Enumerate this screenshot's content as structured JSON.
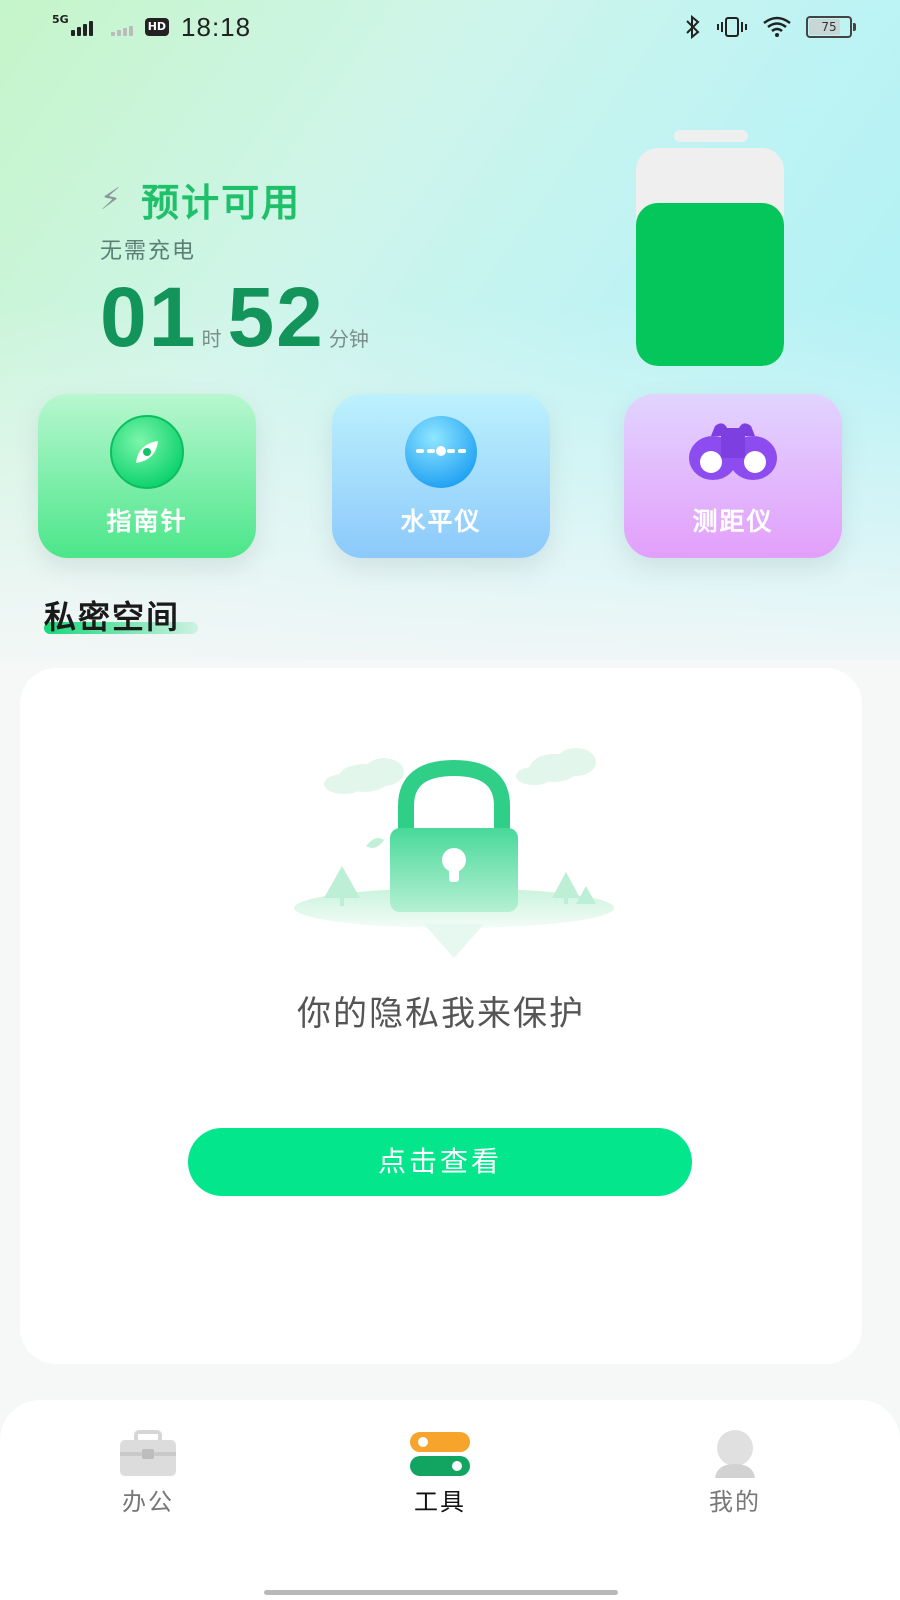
{
  "status_bar": {
    "network": "5G",
    "hd": "HD",
    "time": "18:18",
    "battery": "75"
  },
  "estimate": {
    "title": "预计可用",
    "subtitle": "无需充电",
    "hours": "01",
    "hours_unit": "时",
    "minutes": "52",
    "minutes_unit": "分钟",
    "battery_level": 0.75,
    "accent_color": "#05c65a"
  },
  "tools": [
    {
      "label": "指南针",
      "icon": "compass-icon"
    },
    {
      "label": "水平仪",
      "icon": "level-icon"
    },
    {
      "label": "测距仪",
      "icon": "binoculars-icon"
    }
  ],
  "private_space": {
    "title": "私密空间",
    "message": "你的隐私我来保护",
    "button": "点击查看",
    "illustration": "lock-icon",
    "button_color": "#03e68c"
  },
  "nav": {
    "items": [
      {
        "label": "办公",
        "icon": "briefcase-icon",
        "active": false
      },
      {
        "label": "工具",
        "icon": "toggles-icon",
        "active": true
      },
      {
        "label": "我的",
        "icon": "person-icon",
        "active": false
      }
    ]
  }
}
